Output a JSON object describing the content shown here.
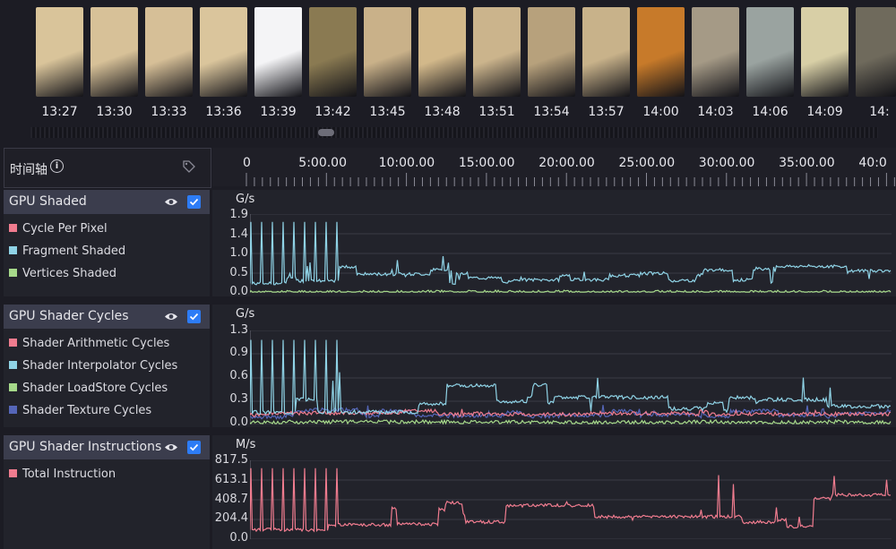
{
  "thumbnails": {
    "times": [
      "13:27",
      "13:30",
      "13:33",
      "13:36",
      "13:39",
      "13:42",
      "13:45",
      "13:48",
      "13:51",
      "13:54",
      "13:57",
      "14:00",
      "14:03",
      "14:06",
      "14:09",
      "14:"
    ],
    "colors": [
      "#d9c49a",
      "#d7c198",
      "#d6bf97",
      "#dac59c",
      "#f4f4f6",
      "#8a7a52",
      "#c9b189",
      "#d2b88a",
      "#cbb48c",
      "#b7a17c",
      "#c8b28a",
      "#c77a2a",
      "#a59a86",
      "#9aa3a0",
      "#d8cfa6",
      "#6f6a5c"
    ]
  },
  "timeline": {
    "title": "时间轴",
    "info_icon": "info-icon",
    "tag_icon": "tag-icon",
    "ruler_labels": [
      "0",
      "5:00.00",
      "10:00.00",
      "15:00.00",
      "20:00.00",
      "25:00.00",
      "30:00.00",
      "35:00.00",
      "40:0"
    ]
  },
  "sections": [
    {
      "title": "GPU Shaded",
      "unit": "G/s",
      "yticks": [
        "1.9",
        "1.4",
        "1.0",
        "0.5",
        "0.0"
      ],
      "legend": [
        {
          "label": "Cycle Per Pixel",
          "color": "#f07c8f"
        },
        {
          "label": "Fragment Shaded",
          "color": "#8fd3e6"
        },
        {
          "label": "Vertices Shaded",
          "color": "#a6d98a"
        }
      ]
    },
    {
      "title": "GPU Shader Cycles",
      "unit": "G/s",
      "yticks": [
        "1.3",
        "0.9",
        "0.6",
        "0.3",
        "0.0"
      ],
      "legend": [
        {
          "label": "Shader Arithmetic Cycles",
          "color": "#f07c8f"
        },
        {
          "label": "Shader Interpolator Cycles",
          "color": "#8fd3e6"
        },
        {
          "label": "Shader LoadStore Cycles",
          "color": "#a6d98a"
        },
        {
          "label": "Shader Texture Cycles",
          "color": "#5566b8"
        }
      ]
    },
    {
      "title": "GPU Shader Instructions",
      "unit": "M/s",
      "yticks": [
        "817.5",
        "613.1",
        "408.7",
        "204.4",
        "0.0"
      ],
      "legend": [
        {
          "label": "Total Instruction",
          "color": "#f07c8f"
        }
      ]
    }
  ]
}
